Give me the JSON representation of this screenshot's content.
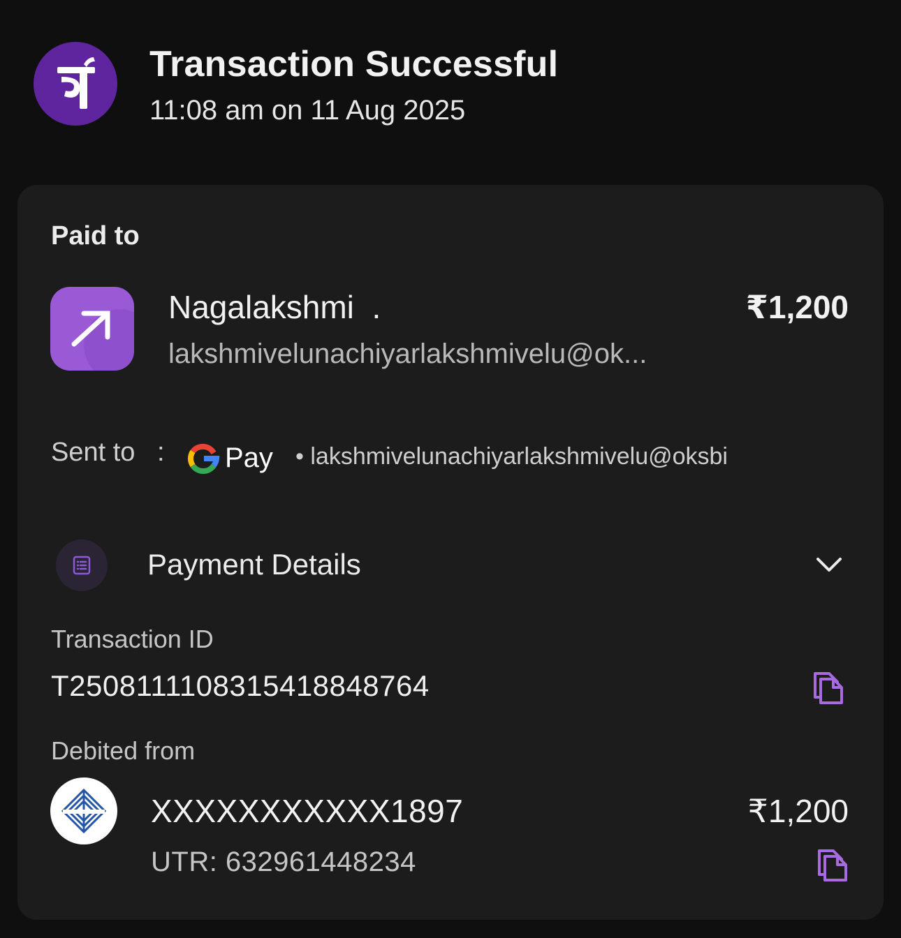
{
  "header": {
    "title": "Transaction Successful",
    "timestamp": "11:08 am on 11 Aug 2025",
    "logo_icon": "phonepe-logo-icon",
    "brand_color": "#5f259f"
  },
  "card": {
    "paid_to_label": "Paid to",
    "payee": {
      "name": "Nagalakshmi  .",
      "upi": "lakshmivelunachiyarlakshmivelu@ok...",
      "amount": "₹1,200",
      "icon": "arrow-up-right-icon",
      "icon_color": "#9a5ad6"
    },
    "sent_to": {
      "label": "Sent to",
      "separator": ":",
      "app": "Pay",
      "upi": "• lakshmivelunachiyarlakshmivelu@oksbi"
    },
    "payment_details": {
      "label": "Payment Details",
      "icon": "receipt-list-icon",
      "chevron": "chevron-down-icon"
    },
    "transaction": {
      "label": "Transaction ID",
      "id": "T2508111108315418848764"
    },
    "debit": {
      "label": "Debited from",
      "account": "XXXXXXXXXXX1897",
      "amount": "₹1,200",
      "utr": "UTR: 632961448234",
      "bank_icon": "bank-logo-icon"
    },
    "accent_color": "#a66be0"
  }
}
